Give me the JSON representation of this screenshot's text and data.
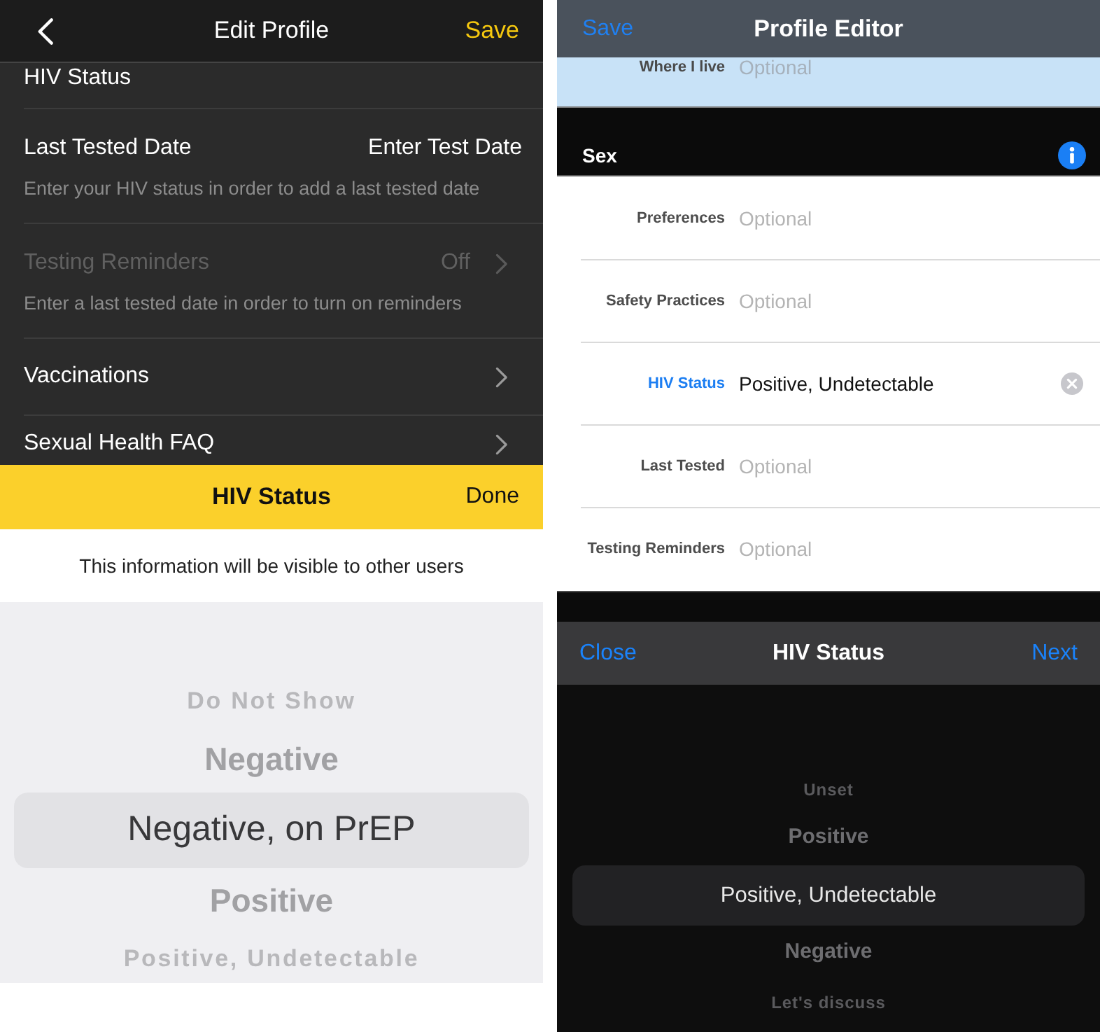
{
  "edit_profile": {
    "nav_bar": {
      "title": "Edit Profile",
      "action": "Save"
    },
    "rows": [
      {
        "label": "HIV Status",
        "chevron": false,
        "disabled": false
      },
      {
        "label": "Last Tested Date",
        "value": "Enter Test Date",
        "description": "Enter your HIV status in order to add a last tested date",
        "chevron": false,
        "disabled": false
      },
      {
        "label": "Testing Reminders",
        "value": "Off",
        "description": "Enter a last tested date in order to turn on reminders",
        "chevron": true,
        "disabled": true
      },
      {
        "label": "Vaccinations",
        "chevron": true,
        "disabled": false
      },
      {
        "label": "Sexual Health FAQ",
        "chevron": true,
        "disabled": false
      }
    ],
    "sheet": {
      "title": "HIV Status",
      "action": "Done",
      "notice": "This information will be visible to other users",
      "options": [
        {
          "label": "Do Not Show",
          "selected": false
        },
        {
          "label": "Negative",
          "selected": false
        },
        {
          "label": "Negative, on PrEP",
          "selected": true
        },
        {
          "label": "Positive",
          "selected": false
        },
        {
          "label": "Positive, Undetectable",
          "selected": false
        }
      ]
    }
  },
  "profile_editor": {
    "nav_bar": {
      "title": "Profile Editor",
      "action": "Save"
    },
    "location_row": {
      "label": "Where I live",
      "placeholder": "Optional"
    },
    "section": {
      "title": "Sex",
      "rows": [
        {
          "label": "Preferences",
          "placeholder": "Optional",
          "selected": false
        },
        {
          "label": "Safety Practices",
          "placeholder": "Optional",
          "selected": false
        },
        {
          "label": "HIV Status",
          "value": "Positive, Undetectable",
          "selected": true
        },
        {
          "label": "Last Tested",
          "placeholder": "Optional",
          "selected": false
        },
        {
          "label": "Testing Reminders",
          "placeholder": "Optional",
          "selected": false
        }
      ]
    },
    "sheet": {
      "close": "Close",
      "title": "HIV Status",
      "next": "Next",
      "options": [
        {
          "label": "Unset",
          "selected": false
        },
        {
          "label": "Positive",
          "selected": false
        },
        {
          "label": "Positive, Undetectable",
          "selected": true
        },
        {
          "label": "Negative",
          "selected": false
        },
        {
          "label": "Let's discuss",
          "selected": false
        }
      ]
    }
  }
}
